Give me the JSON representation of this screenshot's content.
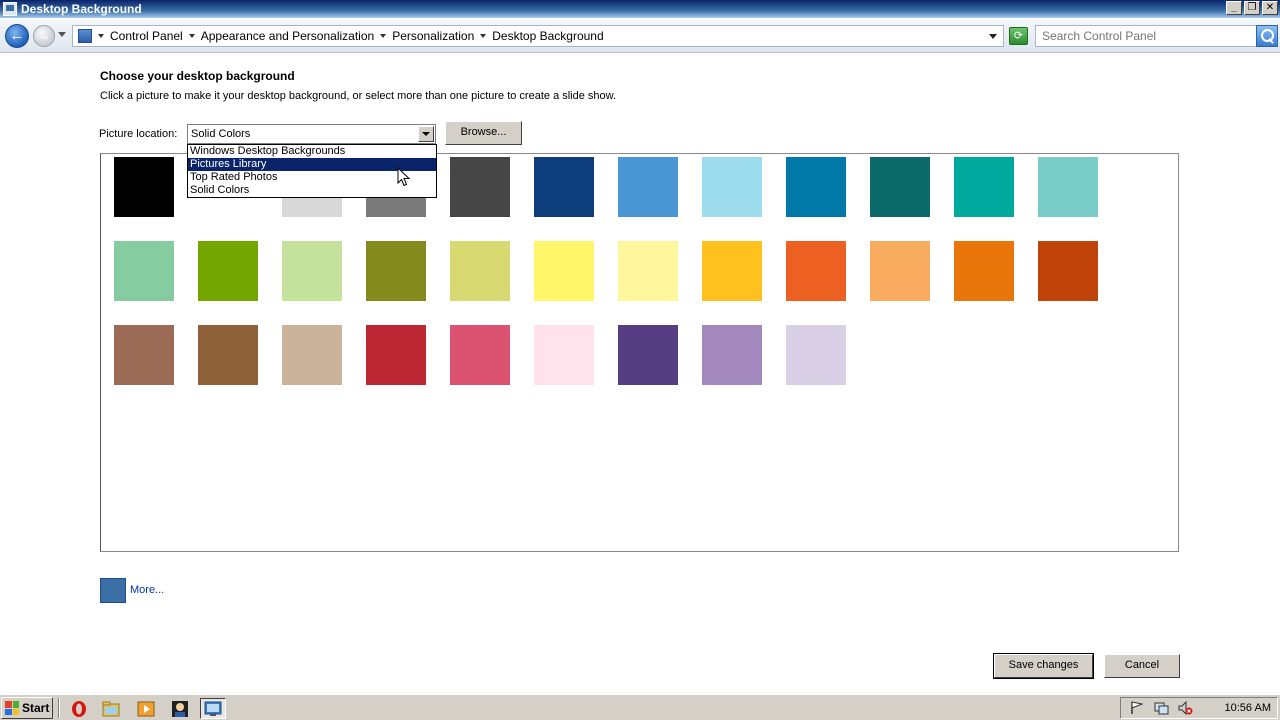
{
  "window": {
    "title": "Desktop Background",
    "controls": [
      "0",
      "2",
      "r"
    ]
  },
  "address": {
    "breadcrumbs": [
      "Control Panel",
      "Appearance and Personalization",
      "Personalization",
      "Desktop Background"
    ],
    "search_placeholder": "Search Control Panel"
  },
  "content": {
    "heading": "Choose your desktop background",
    "subtext": "Click a picture to make it your desktop background, or select more than one picture to create a slide show.",
    "location_label": "Picture location:",
    "location_value": "Solid Colors",
    "browse_label": "Browse...",
    "dropdown_options": [
      "Windows Desktop Backgrounds",
      "Pictures Library",
      "Top Rated Photos",
      "Solid Colors"
    ],
    "dropdown_selected_index": 1,
    "swatches": [
      [
        "#000000",
        "#ffffff",
        "#d9d9d9",
        "#7a7a7a",
        "#464646",
        "#0d3d7a",
        "#4a96d2",
        "#9cdcec",
        "#0078a8",
        "#0c6a6a",
        "#00a99d",
        "#7accc8"
      ],
      [
        "#85cca0",
        "#73a700",
        "#c4e29b",
        "#858a1c",
        "#d9d972",
        "#fff66a",
        "#fff79e",
        "#ffc11d",
        "#ec6121",
        "#f9ac5f",
        "#e8760a",
        "#c0440a"
      ],
      [
        "#9c6b55",
        "#8f6138",
        "#cab29b",
        "#bc2733",
        "#dc5271",
        "#ffe2ec",
        "#553d82",
        "#a388bd",
        "#d9d0e5"
      ]
    ],
    "more_label": "More...",
    "more_color": "#3a6ea5"
  },
  "actions": {
    "save_label": "Save changes",
    "cancel_label": "Cancel"
  },
  "taskbar": {
    "start_label": "Start",
    "clock": "10:56 AM"
  }
}
